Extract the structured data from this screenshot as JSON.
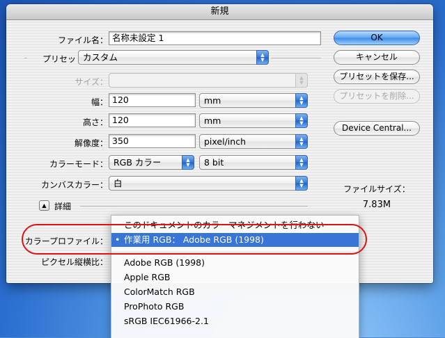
{
  "window": {
    "title": "新規"
  },
  "form": {
    "filename": {
      "label": "ファイル名：",
      "value": "名称未設定 1"
    },
    "preset": {
      "label": "プリセット：",
      "value": "カスタム"
    },
    "size": {
      "label": "サイズ：",
      "value": ""
    },
    "width": {
      "label": "幅：",
      "value": "120",
      "unit": "mm"
    },
    "height": {
      "label": "高さ：",
      "value": "120",
      "unit": "mm"
    },
    "resolution": {
      "label": "解像度：",
      "value": "350",
      "unit": "pixel/inch"
    },
    "color_mode": {
      "label": "カラーモード：",
      "value": "RGB カラー",
      "depth": "8 bit"
    },
    "canvas_color": {
      "label": "カンバスカラー：",
      "value": "白"
    },
    "advanced": {
      "label": "詳細"
    },
    "color_profile": {
      "label": "カラープロファイル："
    },
    "pixel_aspect": {
      "label": "ピクセル縦横比："
    }
  },
  "buttons": {
    "ok": "OK",
    "cancel": "キャンセル",
    "save_preset": "プリセットを保存...",
    "delete_preset": "プリセットを削除...",
    "device_central": "Device Central..."
  },
  "info": {
    "file_size_label": "ファイルサイズ：",
    "file_size_value": "7.83M"
  },
  "menu": {
    "items": [
      "このドキュメントのカラーマネジメントを行わない",
      "作業用 RGB： Adobe RGB (1998)",
      "Adobe RGB (1998)",
      "Apple RGB",
      "ColorMatch RGB",
      "ProPhoto RGB",
      "sRGB IEC61966-2.1"
    ],
    "check_mark": "•"
  },
  "colors": {
    "selection": "#3875d7",
    "highlight_ring": "#e01010"
  }
}
